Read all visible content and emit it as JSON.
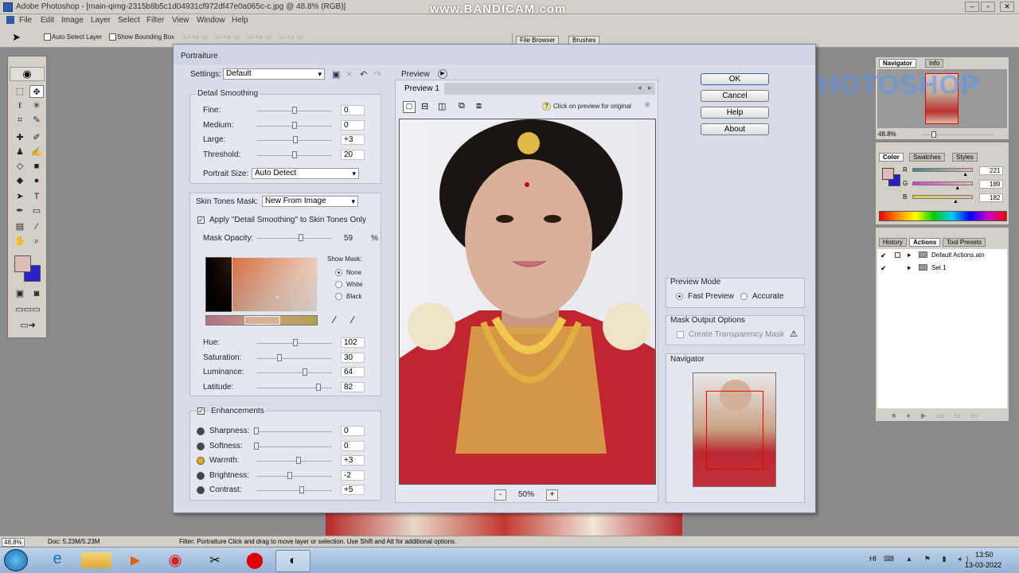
{
  "app": {
    "title": "Adobe Photoshop - [main-qimg-2315b8b5c1d04931cf972df47e0a065c-c.jpg @ 48.8% (RGB)]",
    "watermark": "www.BANDICAM.com",
    "menu": [
      "File",
      "Edit",
      "Image",
      "Layer",
      "Select",
      "Filter",
      "View",
      "Window",
      "Help"
    ],
    "options": {
      "auto_select": "Auto Select Layer",
      "bounding_box": "Show Bounding Box"
    },
    "palette_tabs": [
      "File Browser",
      "Brushes"
    ],
    "overlay_text": "PHOTOSHOP"
  },
  "dialog": {
    "title": "Portraiture",
    "settings_label": "Settings:",
    "settings_value": "Default",
    "detail": {
      "title": "Detail Smoothing",
      "rows": [
        {
          "label": "Fine:",
          "value": "0",
          "pos": 0.5
        },
        {
          "label": "Medium:",
          "value": "0",
          "pos": 0.5
        },
        {
          "label": "Large:",
          "value": "+3",
          "pos": 0.52
        },
        {
          "label": "Threshold:",
          "value": "20",
          "pos": 0.5
        }
      ],
      "portrait_size_label": "Portrait Size:",
      "portrait_size_value": "Auto Detect"
    },
    "skin": {
      "mask_label": "Skin Tones Mask:",
      "mask_value": "New From Image",
      "apply_label": "Apply \"Detail Smoothing\" to Skin Tones Only",
      "opacity_label": "Mask Opacity:",
      "opacity_value": "59",
      "opacity_unit": "%",
      "opacity_pos": 0.59,
      "show_mask_label": "Show Mask:",
      "show_mask_options": [
        "None",
        "White",
        "Black"
      ],
      "rows": [
        {
          "label": "Hue:",
          "value": "102",
          "pos": 0.52
        },
        {
          "label": "Saturation:",
          "value": "30",
          "pos": 0.3
        },
        {
          "label": "Luminance:",
          "value": "64",
          "pos": 0.64
        },
        {
          "label": "Latitude:",
          "value": "82",
          "pos": 0.82
        }
      ]
    },
    "enh": {
      "title": "Enhancements",
      "rows": [
        {
          "label": "Sharpness:",
          "value": "0",
          "pos": 0.0,
          "icon": "sharpness-icon"
        },
        {
          "label": "Softness:",
          "value": "0",
          "pos": 0.0,
          "icon": "softness-icon"
        },
        {
          "label": "Warmth:",
          "value": "+3",
          "pos": 0.56,
          "icon": "warmth-icon"
        },
        {
          "label": "Brightness:",
          "value": "-2",
          "pos": 0.44,
          "icon": "brightness-icon"
        },
        {
          "label": "Contrast:",
          "value": "+5",
          "pos": 0.6,
          "icon": "contrast-icon"
        }
      ]
    },
    "preview": {
      "title": "Preview",
      "tab": "Preview 1",
      "hint": "Click on preview for original",
      "zoom": "50%",
      "zoom_minus": "-",
      "zoom_plus": "+"
    },
    "buttons": {
      "ok": "OK",
      "cancel": "Cancel",
      "help": "Help",
      "about": "About"
    },
    "preview_mode": {
      "title": "Preview Mode",
      "fast": "Fast Preview",
      "accurate": "Accurate"
    },
    "mask_output": {
      "title": "Mask Output Options",
      "create": "Create Transparency Mask"
    },
    "navigator_title": "Navigator"
  },
  "panels": {
    "navigator": {
      "tabs": [
        "Navigator",
        "Info"
      ],
      "zoom": "48.8%"
    },
    "color": {
      "tabs": [
        "Color",
        "Swatches",
        "Styles"
      ],
      "rows": [
        {
          "ch": "R",
          "value": "221",
          "pos": 0.87
        },
        {
          "ch": "G",
          "value": "189",
          "pos": 0.74
        },
        {
          "ch": "B",
          "value": "182",
          "pos": 0.71
        }
      ]
    },
    "actions": {
      "tabs": [
        "History",
        "Actions",
        "Tool Presets"
      ],
      "items": [
        "Default Actions.atn",
        "Set 1"
      ]
    }
  },
  "status": {
    "zoom": "48.8%",
    "doc": "Doc: 5.23M/5.23M",
    "info": "Filter: Portraiture  Click and drag to move layer or selection.  Use Shift and Alt for additional options."
  },
  "taskbar": {
    "lang": "HI",
    "time": "13:50",
    "date": "13-03-2022"
  }
}
